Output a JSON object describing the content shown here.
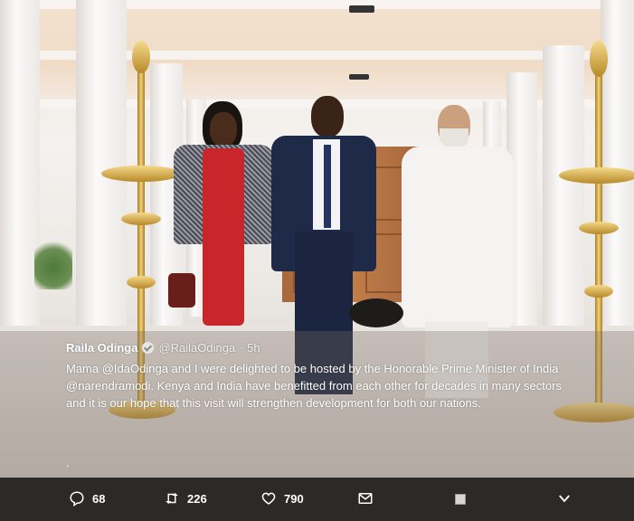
{
  "tweet": {
    "author": "Raila Odinga",
    "handle": "@RailaOdinga",
    "time": "· 5h",
    "text": "Mama  @IdaOdinga and I were delighted to be hosted by the Honorable Prime Minister of India @narendramodi. Kenya and India have benefitted from each other for decades in many sectors and it is our hope that this visit will strengthen development for both our nations."
  },
  "actions": {
    "reply_count": "68",
    "retweet_count": "226",
    "like_count": "790"
  },
  "icons": {
    "reply": "reply-icon",
    "retweet": "retweet-icon",
    "like": "heart-icon",
    "dm": "envelope-icon",
    "more": "chevron-down-icon"
  },
  "colors": {
    "actionbar": "#2c2a28",
    "text": "#ffffff"
  }
}
